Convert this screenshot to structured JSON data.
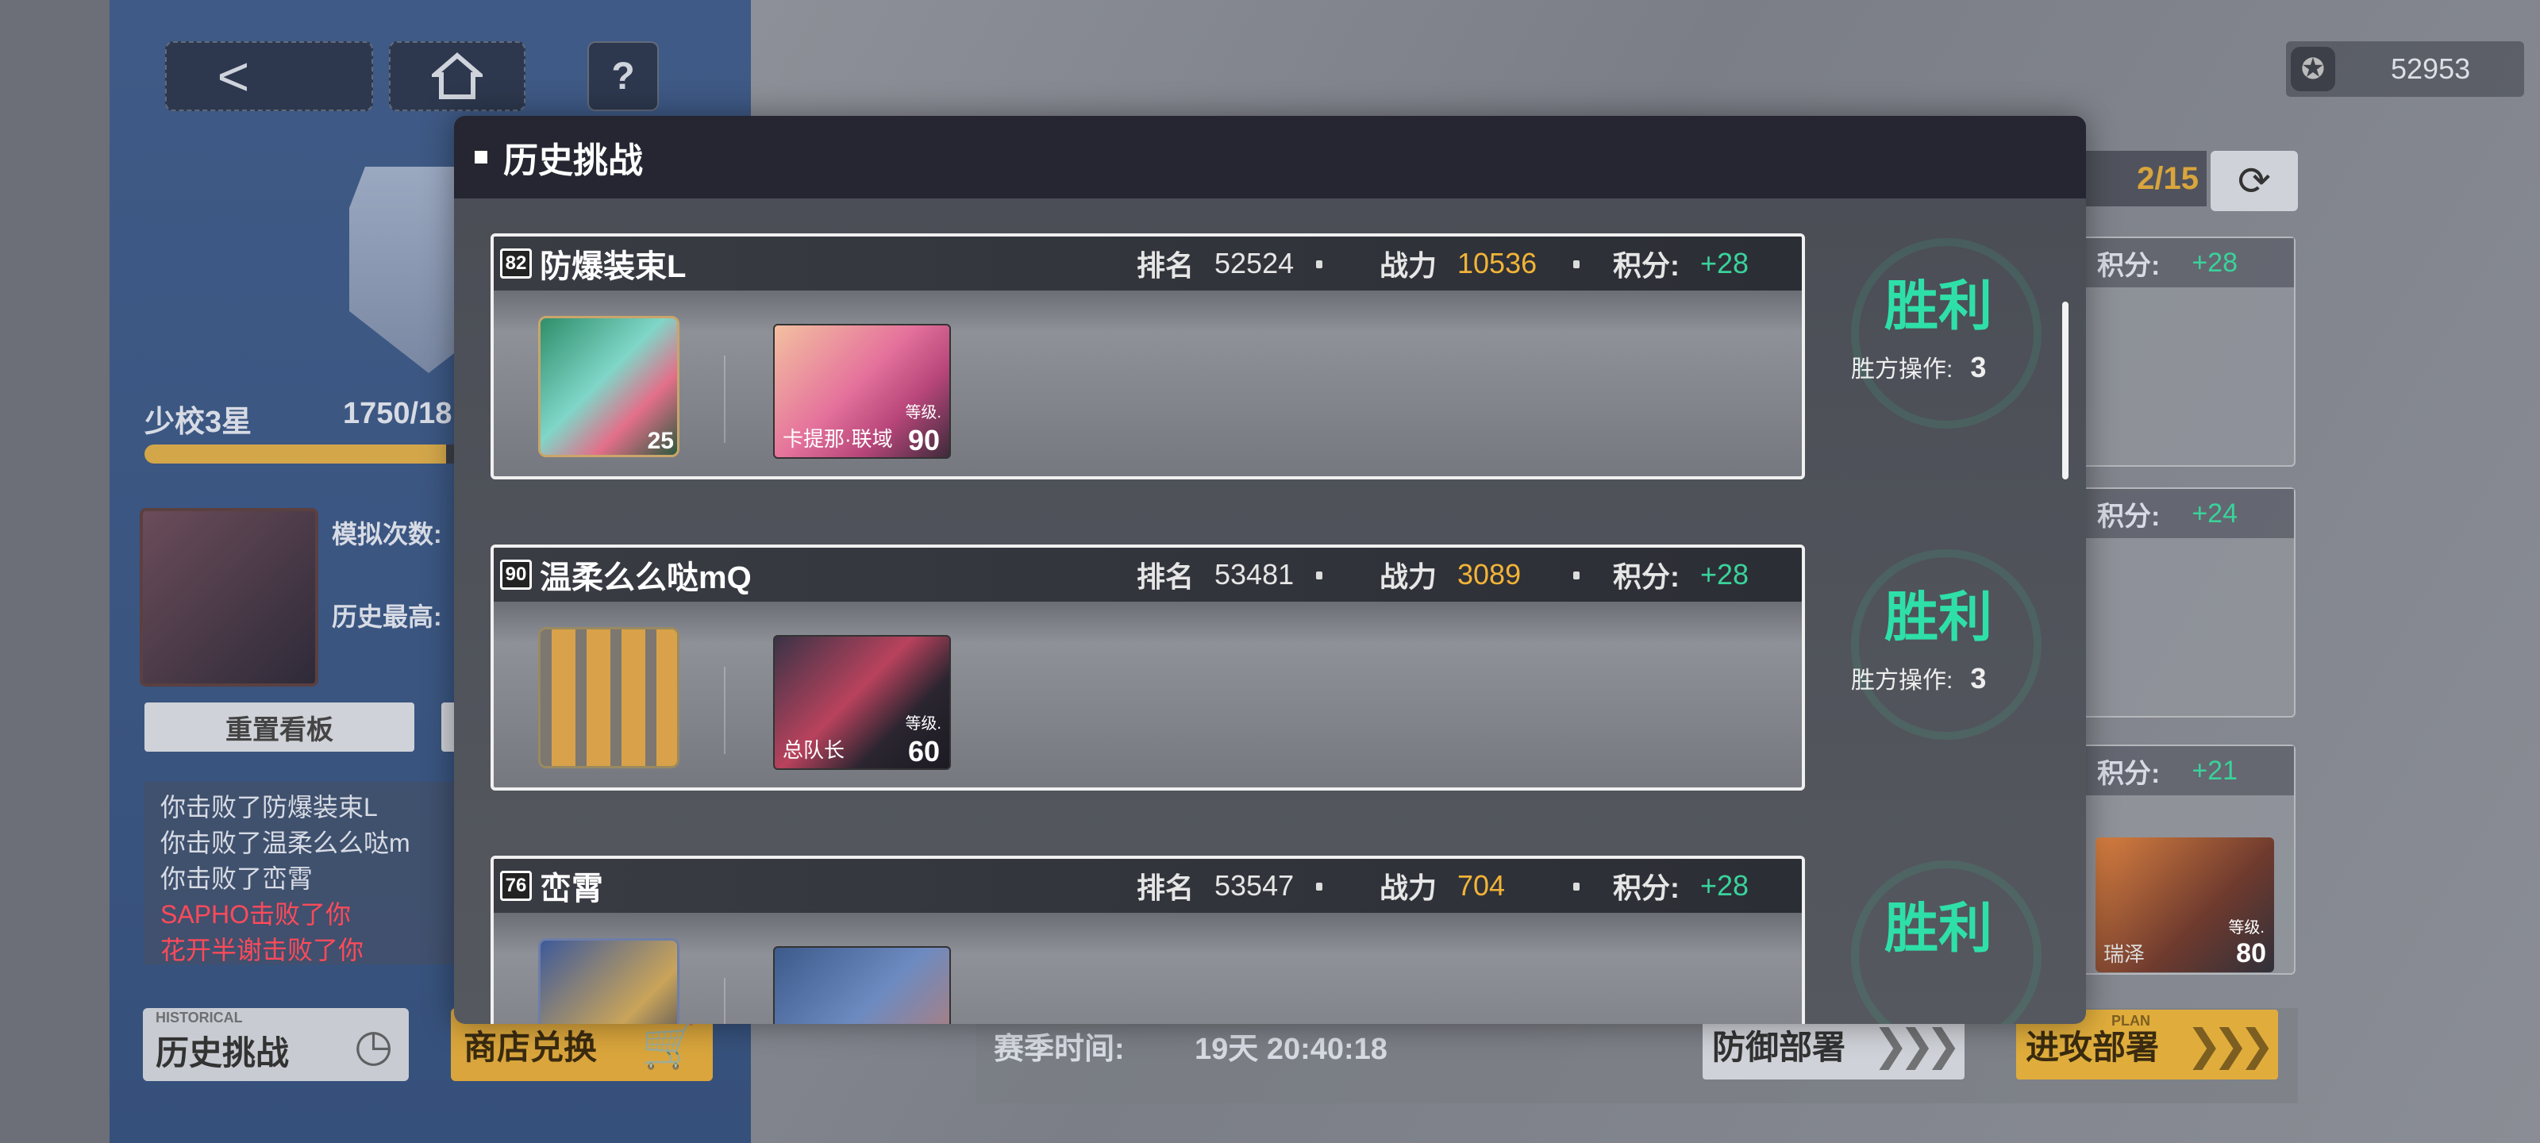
{
  "top_nav": {
    "back_icon": "back-arrow-icon",
    "home_icon": "home-icon",
    "help_label": "?"
  },
  "currency": {
    "icon": "currency-icon",
    "value": "52953"
  },
  "profile": {
    "rank_label": "少校3星",
    "rank_progress_text": "1750/18",
    "rank_progress_fraction": 0.95,
    "simulate_label": "模拟次数:",
    "history_best_label": "历史最高:",
    "reset_board_label": "重置看板"
  },
  "battle_log": [
    {
      "text": "你击败了防爆装束L",
      "kind": "win"
    },
    {
      "text": "你击败了温柔么么哒m",
      "kind": "win"
    },
    {
      "text": "你击败了峦霄",
      "kind": "win"
    },
    {
      "text": "SAPHO击败了你",
      "kind": "loss"
    },
    {
      "text": "花开半谢击败了你",
      "kind": "loss"
    }
  ],
  "bottom_left": {
    "history_small": "HISTORICAL",
    "history_label": "历史挑战",
    "shop_label": "商店兑换"
  },
  "opponents_panel": {
    "counter_text": "2/15",
    "refresh_icon": "refresh-icon",
    "cards": [
      {
        "points_label": "积分:",
        "points": "+28"
      },
      {
        "points_label": "积分:",
        "points": "+24"
      },
      {
        "points_label": "积分:",
        "points": "+21",
        "char_name": "瑞泽",
        "char_level_label": "等级.",
        "char_level": "80"
      }
    ]
  },
  "season": {
    "label": "赛季时间:",
    "time": "19天 20:40:18",
    "defense_label": "防御部署",
    "attack_small": "PLAN",
    "attack_label": "进攻部署"
  },
  "modal": {
    "title": "历史挑战",
    "rank_key": "排名",
    "power_key": "战力",
    "points_key": "积分:",
    "level_label": "等级.",
    "operations_label": "胜方操作:",
    "records": [
      {
        "level": "82",
        "name": "防爆装束L",
        "rank": "52524",
        "power": "10536",
        "points": "+28",
        "team_level": "25",
        "char_name": "卡提那·联域",
        "char_level": "90",
        "result": "胜利",
        "operations": "3"
      },
      {
        "level": "90",
        "name": "温柔么么哒mQ",
        "rank": "53481",
        "power": "3089",
        "points": "+28",
        "team_level": "",
        "char_name": "总队长",
        "char_level": "60",
        "result": "胜利",
        "operations": "3"
      },
      {
        "level": "76",
        "name": "峦霄",
        "rank": "53547",
        "power": "704",
        "points": "+28",
        "team_level": "",
        "char_name": "",
        "char_level": "",
        "result": "胜利",
        "operations": ""
      }
    ]
  },
  "colors": {
    "victory": "#2ee0a8",
    "points": "#39d39b",
    "power": "#f2b437",
    "loss_log": "#ff4a5a",
    "accent_gold": "#d9a53c"
  }
}
